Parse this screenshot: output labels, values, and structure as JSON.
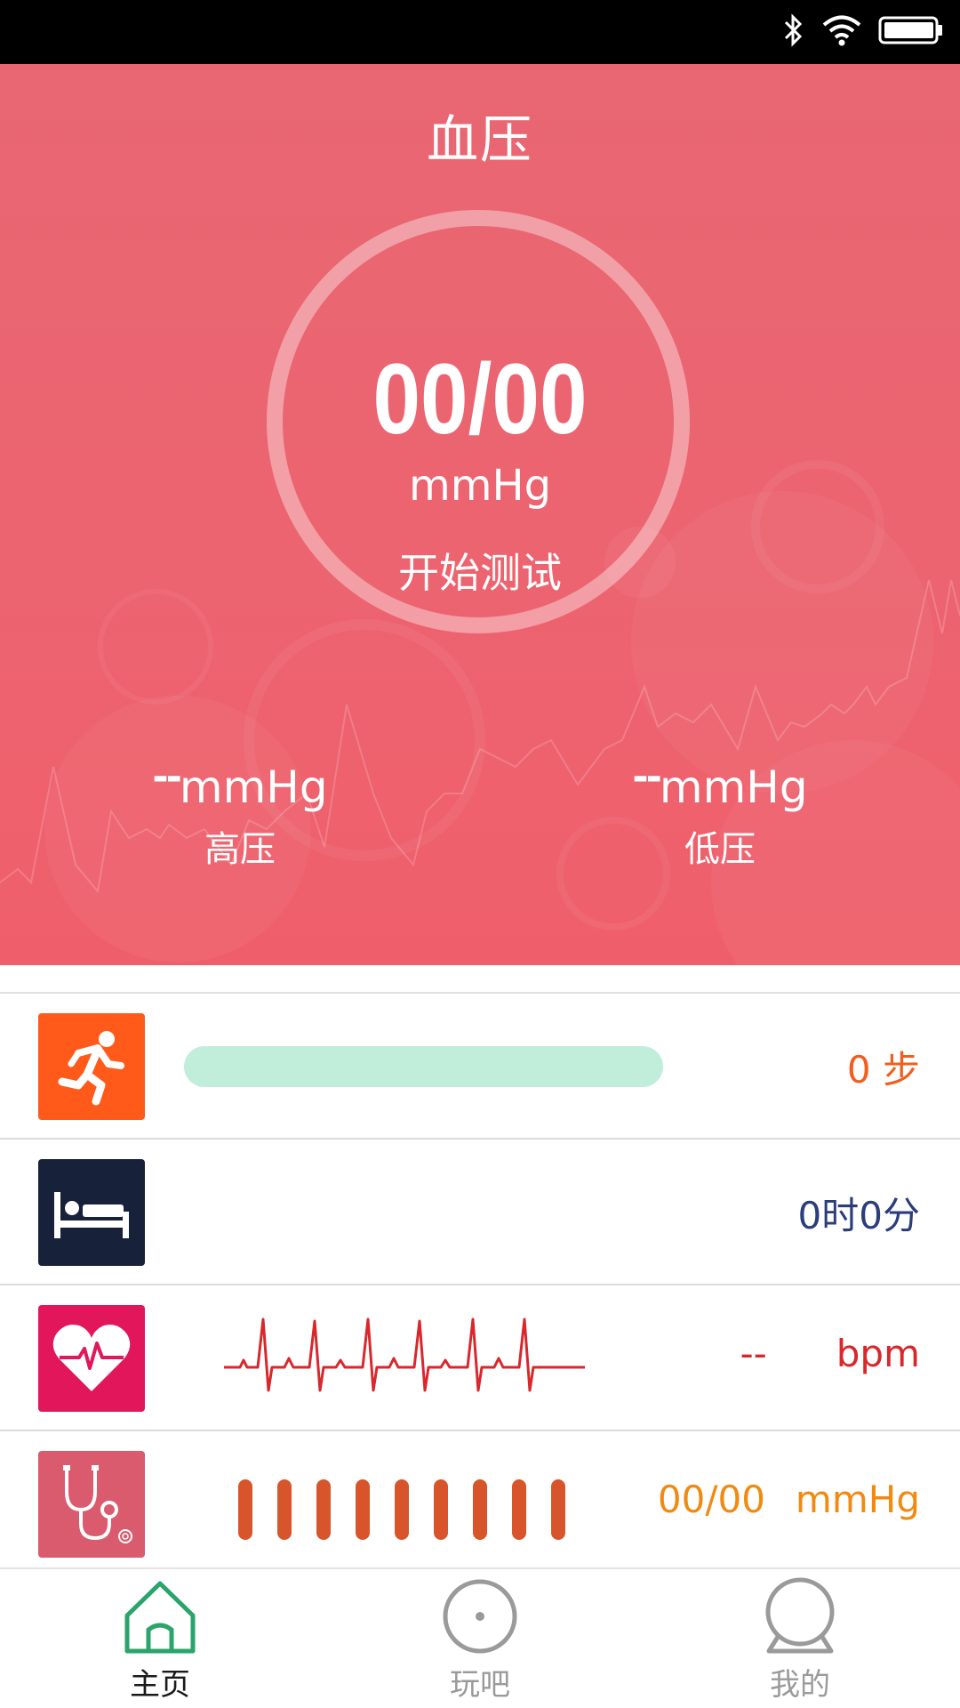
{
  "header": {
    "title": "血压"
  },
  "gauge": {
    "value": "00/00",
    "unit": "mmHg",
    "action_label": "开始测试"
  },
  "systolic": {
    "dash": "--",
    "unit": "mmHg",
    "label": "高压"
  },
  "diastolic": {
    "dash": "--",
    "unit": "mmHg",
    "label": "低压"
  },
  "rows": {
    "steps": {
      "value": "0 步",
      "progress": 0,
      "color": "#f05f1f",
      "icon_bg": "#ff5a1a",
      "track_color": "#c1eddb",
      "icon": "running-person-icon"
    },
    "sleep": {
      "value": "0时0分",
      "color": "#2b3d7a",
      "icon_bg": "#18213a",
      "icon": "bed-icon"
    },
    "heart": {
      "dash": "--",
      "unit": "bpm",
      "color": "#d9272c",
      "icon_bg": "#e2165a",
      "icon": "heart-pulse-icon"
    },
    "pressure": {
      "value": "00/00",
      "unit": "mmHg",
      "color": "#f08a12",
      "icon_bg": "#d95b6d",
      "bar_color": "#d8552b",
      "icon": "stethoscope-icon"
    }
  },
  "nav": {
    "items": [
      {
        "label": "主页",
        "icon": "home-icon",
        "active": true,
        "color": "#2aa46a"
      },
      {
        "label": "玩吧",
        "icon": "circle-dot-icon",
        "active": false,
        "color": "#9a9a9a"
      },
      {
        "label": "我的",
        "icon": "person-icon",
        "active": false,
        "color": "#9a9a9a"
      }
    ]
  }
}
